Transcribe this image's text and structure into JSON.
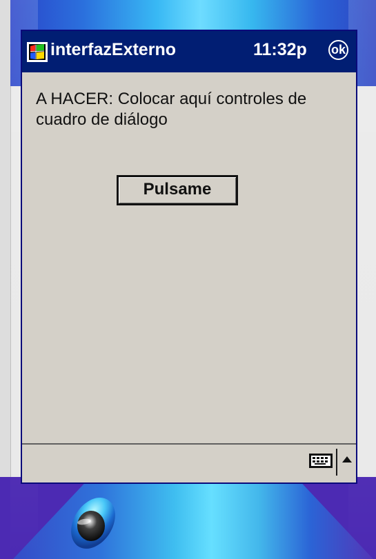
{
  "app": {
    "title": "interfazExterno",
    "clock": "11:32p",
    "ok_label": "ok"
  },
  "dialog": {
    "instructions": "A HACER: Colocar aquí controles de cuadro de diálogo",
    "button_label": "Pulsame"
  },
  "taskbar": {
    "input_icon": "keyboard-icon",
    "input_toggle_icon": "arrow-up-icon"
  },
  "colors": {
    "title_bar": "#011e73",
    "dialog_background": "#d4d0c8",
    "text": "#111111"
  }
}
